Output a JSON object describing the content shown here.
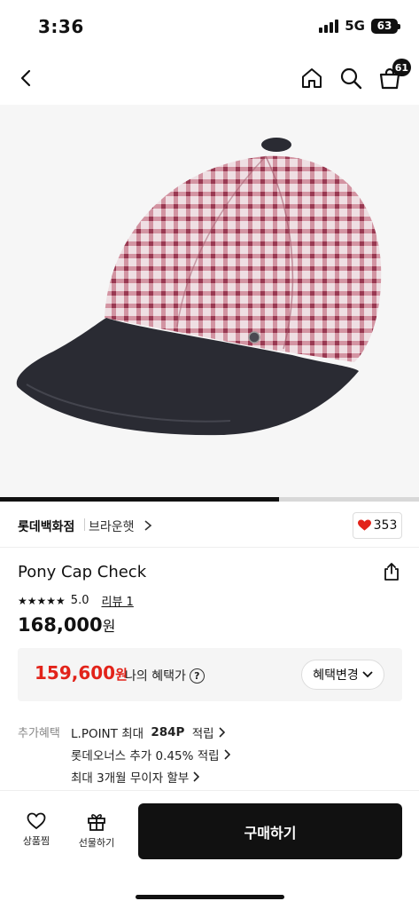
{
  "status_bar": {
    "time": "3:36",
    "network": "5G",
    "battery": "63"
  },
  "nav": {
    "cart_count": "61",
    "icons": [
      "back-chevron-icon",
      "home-icon",
      "search-icon",
      "shopping-bag-icon"
    ]
  },
  "gallery": {
    "progress": 0.665
  },
  "brand": {
    "store": "롯데백화점",
    "name": "브라운햇",
    "likes": "353"
  },
  "product": {
    "title": "Pony Cap Check",
    "rating": "5.0",
    "review_label": "리뷰 1",
    "price": "168,000",
    "price_unit": "원"
  },
  "benefit": {
    "price": "159,600",
    "price_unit": "원",
    "label": "나의 혜택가",
    "help": "?",
    "change_button": "혜택변경"
  },
  "extra_benefits": {
    "label": "추가혜택",
    "items": [
      {
        "pre": "L.POINT 최대 ",
        "bold": "284P",
        "post": " 적립"
      },
      {
        "pre": "롯데오너스 추가 0.45% 적립",
        "bold": "",
        "post": ""
      },
      {
        "pre": "최대 3개월 무이자 할부",
        "bold": "",
        "post": ""
      }
    ]
  },
  "bottom_bar": {
    "wish_label": "상품찜",
    "gift_label": "선물하기",
    "buy_label": "구매하기"
  },
  "colors": {
    "accent_red": "#e2231a",
    "heart": "#e2231a",
    "dark": "#111111",
    "cap_check_pink": "#c97a8c",
    "cap_brim": "#2a2b33"
  }
}
